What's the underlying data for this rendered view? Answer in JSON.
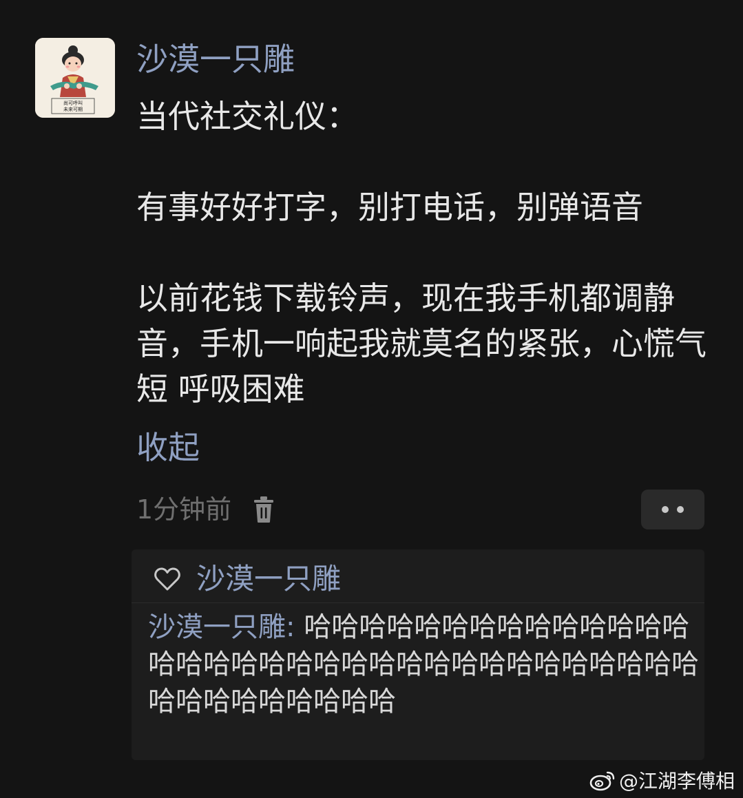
{
  "post": {
    "author": "沙漠一只雕",
    "paragraphs": [
      "当代社交礼仪：",
      "有事好好打字，别打电话，别弹语音",
      "以前花钱下载铃声，现在我手机都调静音，手机一响起我就莫名的紧张，心慌气短 呼吸困难"
    ],
    "collapse_label": "收起",
    "timestamp": "1分钟前"
  },
  "avatar": {
    "caption_line1": "尚可呼叫",
    "caption_line2": "未来可期"
  },
  "icons": {
    "trash": "trash-icon",
    "more": "more-dots-icon",
    "heart": "heart-outline-icon",
    "weibo": "weibo-logo-icon"
  },
  "interactions": {
    "liked_by": "沙漠一只雕",
    "comments": [
      {
        "author": "沙漠一只雕",
        "separator": ": ",
        "text": "哈哈哈哈哈哈哈哈哈哈哈哈哈哈哈哈哈哈哈哈哈哈哈哈哈哈哈哈哈哈哈哈哈哈哈哈哈哈哈哈哈哈哈"
      }
    ]
  },
  "watermark": {
    "handle": "@江湖李傅相"
  },
  "colors": {
    "background": "#141414",
    "link": "#8fa0c2",
    "text": "#e8e8e8",
    "muted": "#6f6f6f",
    "panel": "#1d1d1d"
  }
}
